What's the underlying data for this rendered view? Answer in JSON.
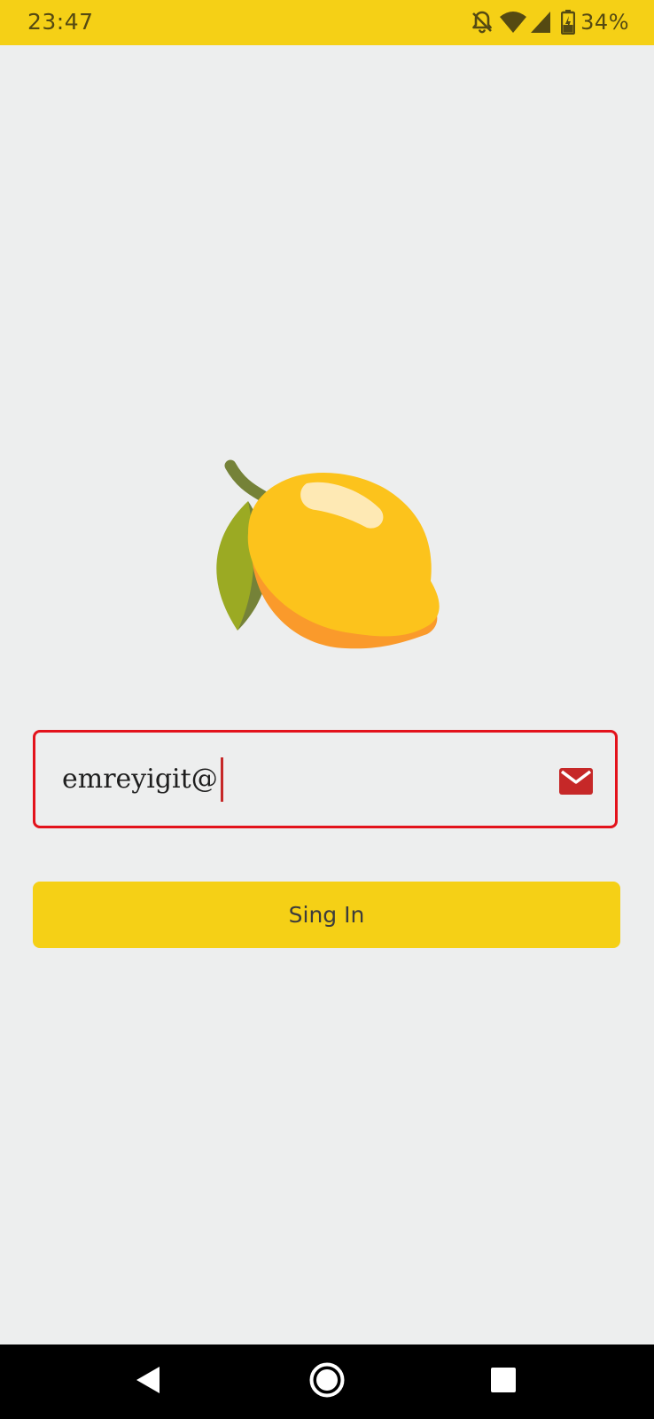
{
  "status_bar": {
    "time": "23:47",
    "battery_percent": "34%",
    "icons": [
      "notifications-off-icon",
      "wifi-icon",
      "cellular-signal-icon",
      "battery-charging-icon"
    ],
    "background_color": "#F5D016"
  },
  "logo": {
    "icon": "lemon-icon"
  },
  "email_field": {
    "value": "emreyigit@",
    "icon": "mail-icon",
    "border_color": "#E3121B",
    "icon_color": "#C62828"
  },
  "signin_button": {
    "label": "Sing In",
    "background_color": "#F5D016"
  },
  "nav_bar": {
    "buttons": [
      "back-icon",
      "home-icon",
      "recents-icon"
    ]
  }
}
